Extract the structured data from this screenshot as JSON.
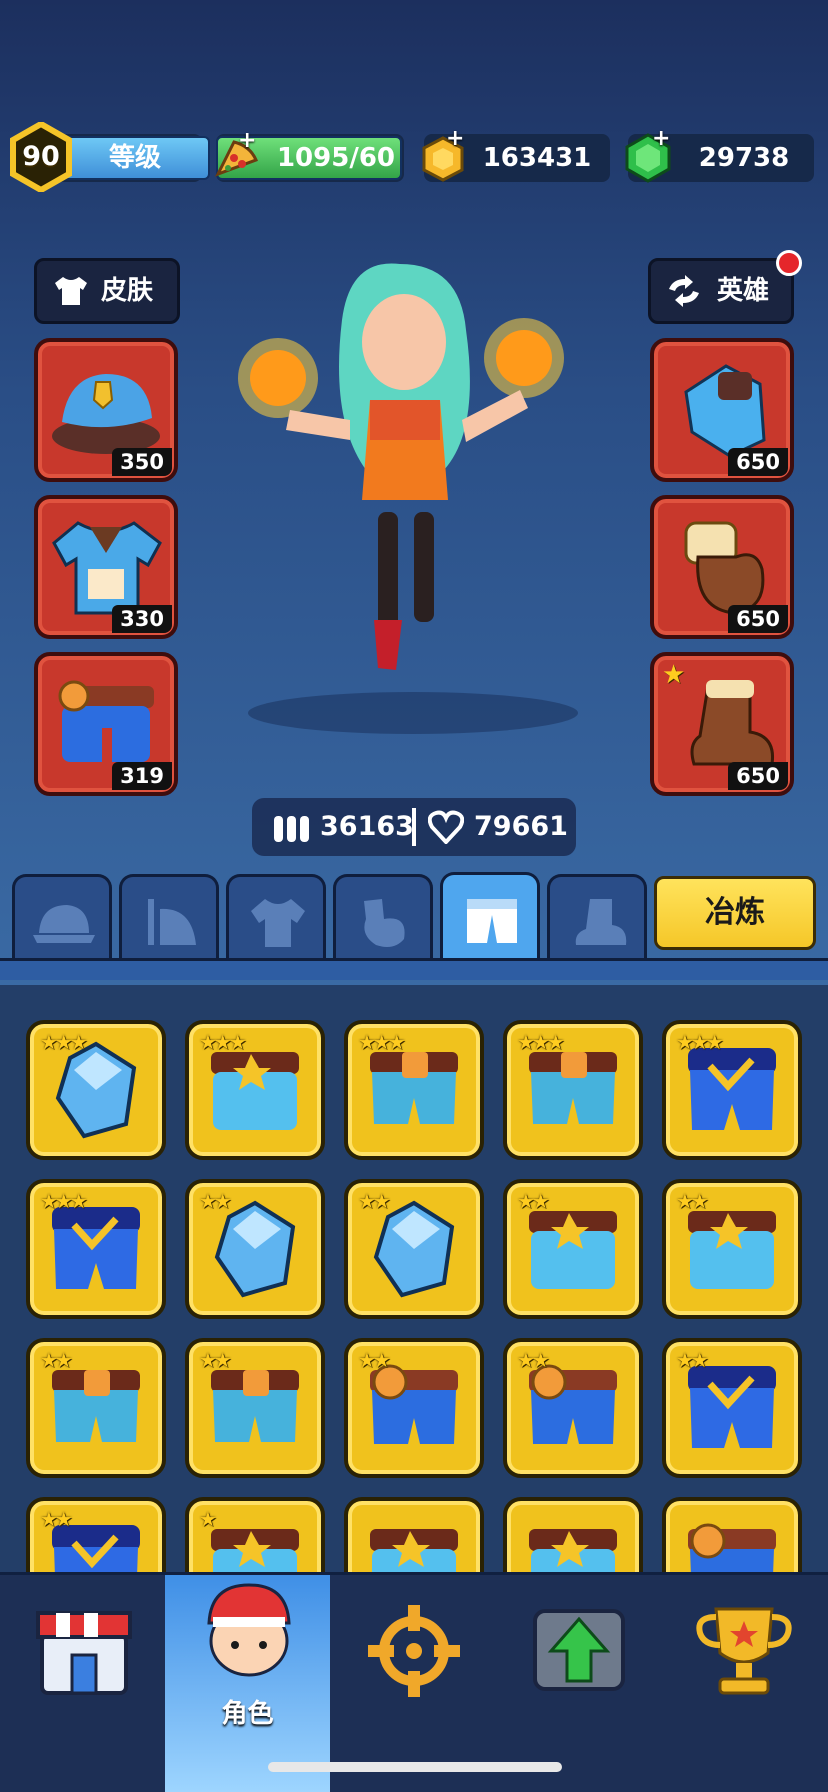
{
  "player": {
    "level": "90",
    "level_label": "等级"
  },
  "resources": {
    "energy": "1095/60",
    "coins": "163431",
    "gems": "29738"
  },
  "buttons": {
    "skin_label": "皮肤",
    "hero_label": "英雄",
    "smelt_label": "冶炼"
  },
  "equipment": {
    "left": [
      {
        "name": "hat",
        "level": "350"
      },
      {
        "name": "shirt",
        "level": "330"
      },
      {
        "name": "pants",
        "level": "319"
      }
    ],
    "right": [
      {
        "name": "armor",
        "level": "650"
      },
      {
        "name": "glove",
        "level": "650"
      },
      {
        "name": "boot",
        "level": "650",
        "starred": true
      }
    ]
  },
  "hero_stats": {
    "attack": "36163",
    "health": "79661"
  },
  "tabs": [
    "hat",
    "cape",
    "shirt",
    "glove",
    "pants",
    "boot"
  ],
  "active_tab": "pants",
  "inventory": [
    {
      "kind": "crystal",
      "stars": 3
    },
    {
      "kind": "pants-light",
      "stars": 3
    },
    {
      "kind": "pants-teal",
      "stars": 3
    },
    {
      "kind": "pants-teal",
      "stars": 3
    },
    {
      "kind": "pants-blue",
      "stars": 3
    },
    {
      "kind": "pants-blue",
      "stars": 3
    },
    {
      "kind": "crystal",
      "stars": 2
    },
    {
      "kind": "crystal",
      "stars": 2
    },
    {
      "kind": "pants-light",
      "stars": 2
    },
    {
      "kind": "pants-light",
      "stars": 2
    },
    {
      "kind": "pants-teal",
      "stars": 2
    },
    {
      "kind": "pants-teal",
      "stars": 2
    },
    {
      "kind": "pants-orange",
      "stars": 2
    },
    {
      "kind": "pants-orange",
      "stars": 2
    },
    {
      "kind": "pants-blue",
      "stars": 2
    },
    {
      "kind": "pants-blue",
      "stars": 2
    },
    {
      "kind": "pants-light",
      "stars": 1
    },
    {
      "kind": "pants-light",
      "stars": 0
    },
    {
      "kind": "pants-light",
      "stars": 0
    },
    {
      "kind": "pants-orange",
      "stars": 0
    }
  ],
  "nav": [
    {
      "name": "shop",
      "label": ""
    },
    {
      "name": "character",
      "label": "角色"
    },
    {
      "name": "battle",
      "label": ""
    },
    {
      "name": "upgrade",
      "label": ""
    },
    {
      "name": "trophy",
      "label": ""
    }
  ],
  "colors": {
    "slot_red": "#c8382c",
    "item_gold": "#f0c21d",
    "tab_active": "#4fa6ee",
    "smelt_yellow": "#ffe35c"
  }
}
